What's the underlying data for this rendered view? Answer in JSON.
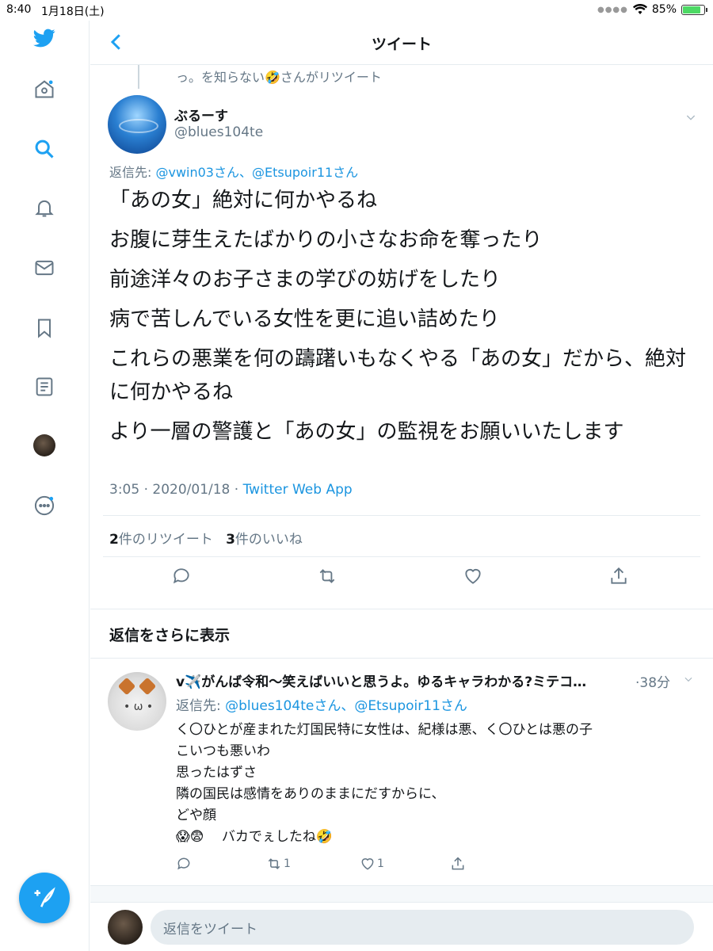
{
  "status_bar": {
    "time": "8:40",
    "date": "1月18日(土)",
    "battery": "85%",
    "battery_level": 0.85
  },
  "header": {
    "title": "ツイート"
  },
  "retweet_context": "っ。を知らない🤣さんがリツイート",
  "tweet": {
    "name": "ぶるーす",
    "handle": "@blues104te",
    "reply_prefix": "返信先: ",
    "reply_to": "@vwin03さん、@Etsupoir11さん",
    "lines": [
      "「あの女」絶対に何かやるね",
      "お腹に芽生えたばかりの小さなお命を奪ったり",
      "前途洋々のお子さまの学びの妨げをしたり",
      "病で苦しんでいる女性を更に追い詰めたり",
      "これらの悪業を何の躊躇いもなくやる「あの女」だから、絶対に何かやるね",
      "より一層の警護と「あの女」の監視をお願いいたします"
    ],
    "timestamp": "3:05 · 2020/01/18 · ",
    "source": "Twitter Web App",
    "retweet_count": "2",
    "retweet_label": "件のリツイート",
    "like_count": "3",
    "like_label": "件のいいね"
  },
  "more_replies_title": "返信をさらに表示",
  "reply": {
    "name": "v✈️がんば令和〜笑えばいいと思うよ。ゆるキャラわかる?ミテコ…",
    "time": "·38分",
    "reply_prefix": "返信先: ",
    "reply_to": "@blues104teさん、@Etsupoir11さん",
    "lines": [
      "く〇ひとが産まれた灯国民特に女性は、紀様は悪、く〇ひとは悪の子",
      "こいつも悪いわ",
      "思ったはずさ",
      "隣の国民は感情をありのままにだすからに、",
      "どや顔",
      "😱😨　 バカでぇしたね🤣"
    ],
    "retweets": "1",
    "likes": "1"
  },
  "compose_placeholder": "返信をツイート",
  "colors": {
    "accent": "#1da1f2",
    "link": "#1b95e0",
    "muted": "#657786"
  },
  "icons": [
    "twitter-logo-icon",
    "home-icon",
    "search-icon",
    "bell-icon",
    "mail-icon",
    "bookmark-icon",
    "list-icon",
    "profile-avatar",
    "more-icon",
    "compose-icon",
    "reply-icon",
    "retweet-icon",
    "like-icon",
    "share-icon",
    "back-icon",
    "chevron-down-icon"
  ]
}
